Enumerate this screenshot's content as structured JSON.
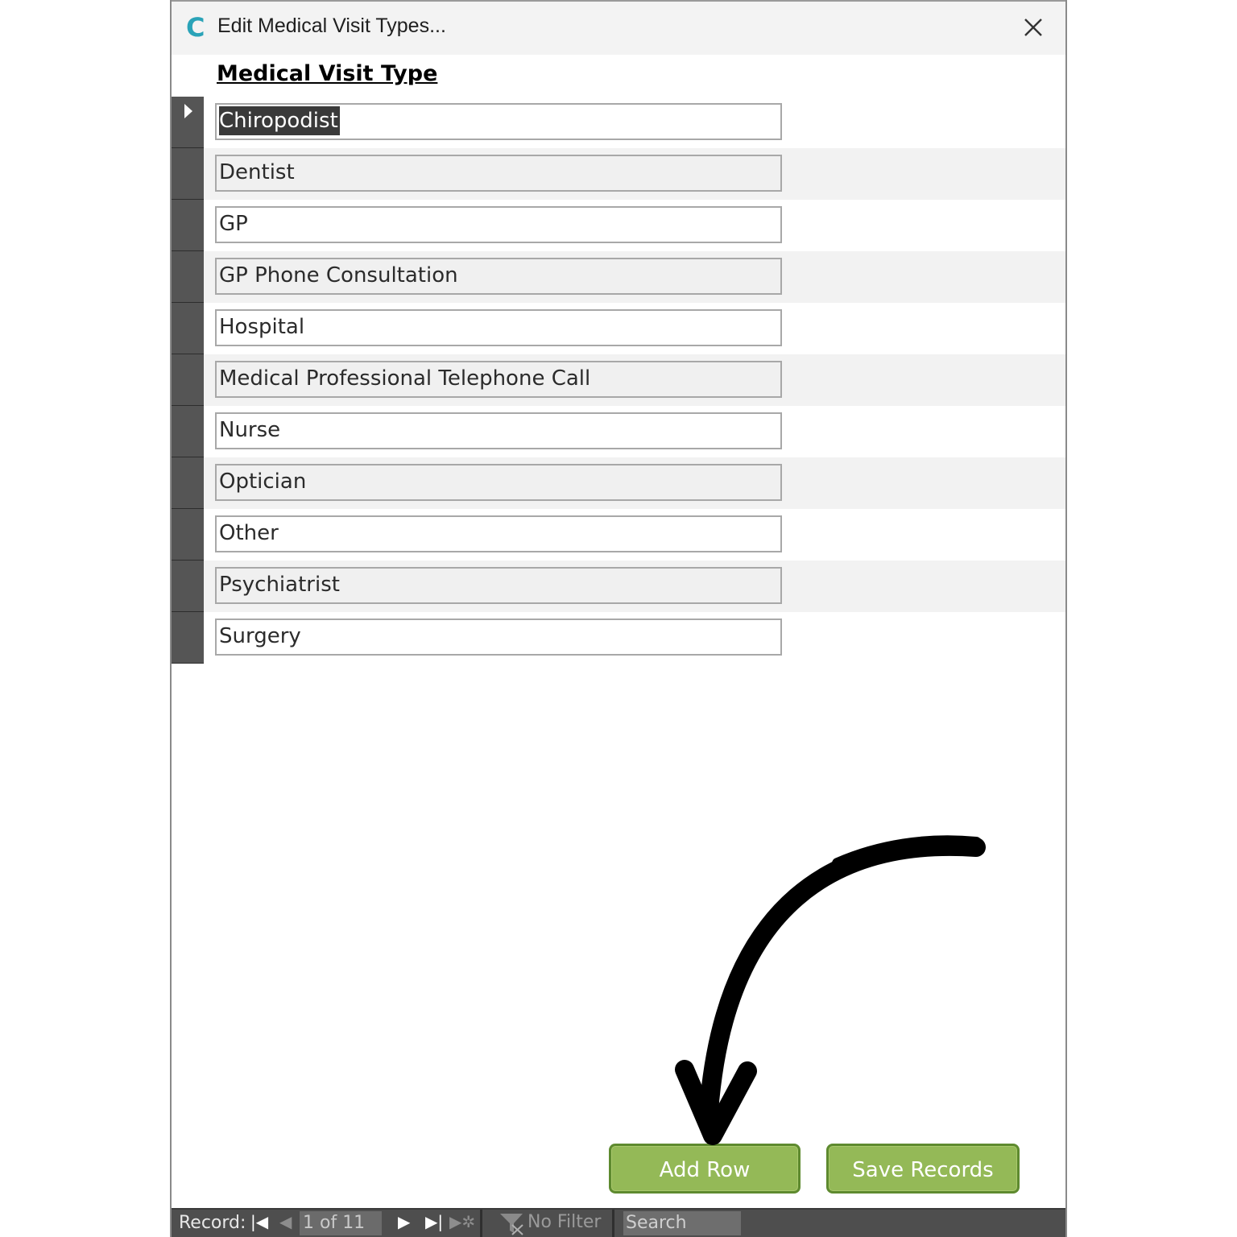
{
  "window": {
    "title": "Edit Medical Visit Types...",
    "app_icon_letter": "C",
    "app_icon_color": "#2aa3b8"
  },
  "table": {
    "column_header": "Medical Visit Type",
    "rows": [
      {
        "value": "Chiropodist",
        "current": true
      },
      {
        "value": "Dentist"
      },
      {
        "value": "GP"
      },
      {
        "value": "GP Phone Consultation"
      },
      {
        "value": "Hospital"
      },
      {
        "value": "Medical Professional Telephone Call"
      },
      {
        "value": "Nurse"
      },
      {
        "value": "Optician"
      },
      {
        "value": "Other"
      },
      {
        "value": "Psychiatrist"
      },
      {
        "value": "Surgery"
      }
    ]
  },
  "buttons": {
    "add_row": "Add Row",
    "save_records": "Save Records",
    "color": "#94b957"
  },
  "navigation": {
    "record_label": "Record:",
    "record_count": "1 of 11",
    "filter_label": "No Filter",
    "search_placeholder": "Search"
  }
}
